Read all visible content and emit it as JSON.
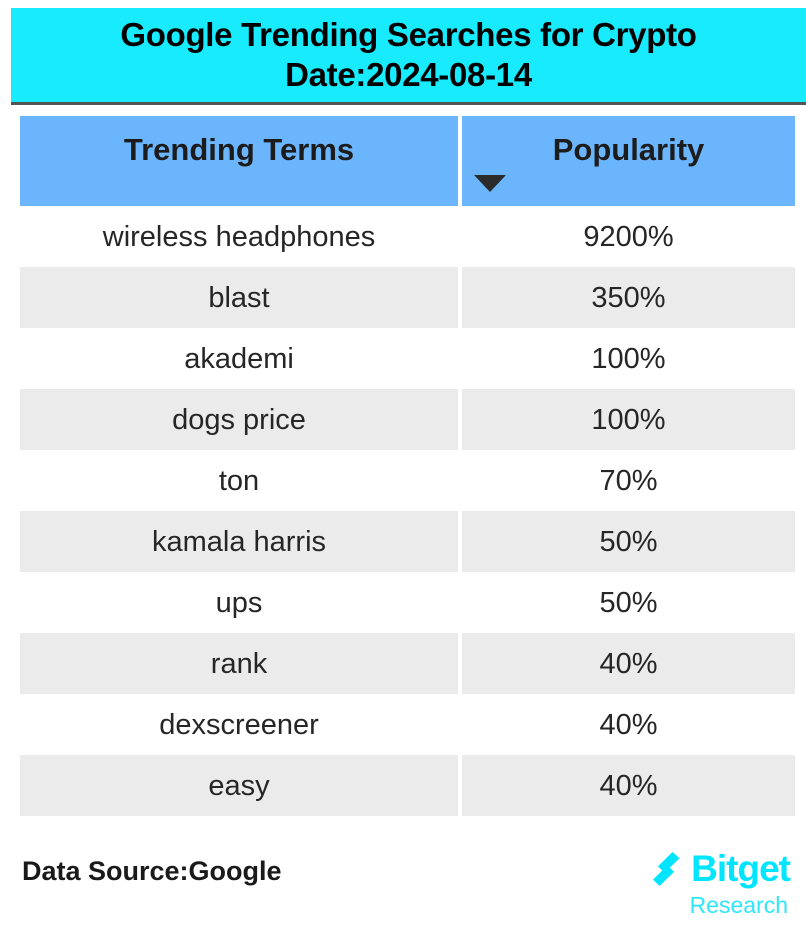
{
  "title": {
    "line1": "Google Trending Searches for Crypto",
    "line2": "Date:2024-08-14",
    "background_color": "#19ebff"
  },
  "table": {
    "header_background_color": "#6bb5fc",
    "row_alt_color": "#ebebeb",
    "columns": [
      {
        "key": "term",
        "label": "Trending Terms",
        "sorted": false
      },
      {
        "key": "popularity",
        "label": "Popularity",
        "sorted": true,
        "sort_direction": "desc",
        "sort_icon": "caret-down-icon"
      }
    ],
    "rows": [
      {
        "term": "wireless headphones",
        "popularity": "9200%"
      },
      {
        "term": "blast",
        "popularity": "350%"
      },
      {
        "term": "akademi",
        "popularity": "100%"
      },
      {
        "term": "dogs price",
        "popularity": "100%"
      },
      {
        "term": "ton",
        "popularity": "70%"
      },
      {
        "term": "kamala harris",
        "popularity": "50%"
      },
      {
        "term": "ups",
        "popularity": "50%"
      },
      {
        "term": "rank",
        "popularity": "40%"
      },
      {
        "term": "dexscreener",
        "popularity": "40%"
      },
      {
        "term": "easy",
        "popularity": "40%"
      }
    ]
  },
  "footer": {
    "data_source": "Data Source:Google",
    "brand_name": "Bitget",
    "brand_sub": "Research",
    "brand_color": "#00e5ff",
    "brand_mark_icon": "bitget-chevron-logo-icon"
  },
  "chart_data": {
    "type": "table",
    "title": "Google Trending Searches for Crypto Date:2024-08-14",
    "categories": [
      "wireless headphones",
      "blast",
      "akademi",
      "dogs price",
      "ton",
      "kamala harris",
      "ups",
      "rank",
      "dexscreener",
      "easy"
    ],
    "values": [
      9200,
      350,
      100,
      100,
      70,
      50,
      50,
      40,
      40,
      40
    ],
    "xlabel": "Trending Terms",
    "ylabel": "Popularity",
    "unit": "%",
    "sort": "popularity descending"
  }
}
